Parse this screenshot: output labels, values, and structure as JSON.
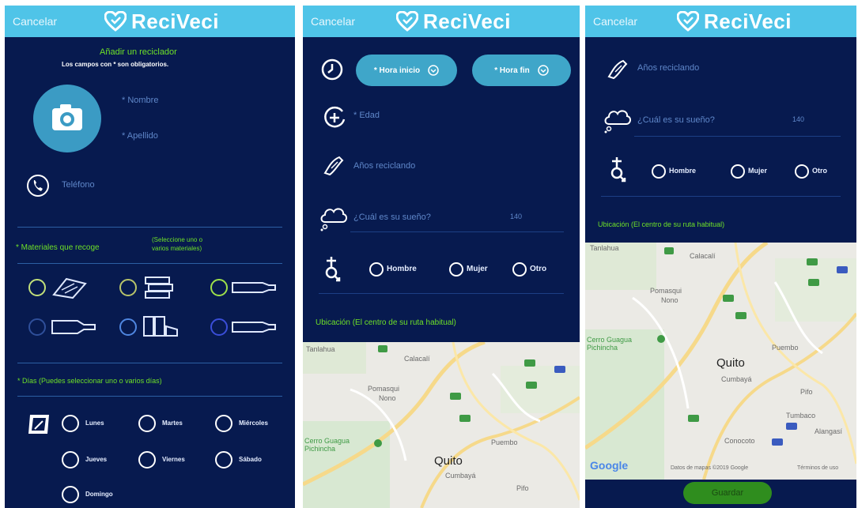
{
  "app": {
    "brand": "ReciVeci",
    "cancel_label": "Cancelar"
  },
  "screen1": {
    "title": "Añadir un reciclador",
    "required_note": "Los campos con * son obligatorios.",
    "name_placeholder": "* Nombre",
    "lastname_placeholder": "* Apellido",
    "phone_placeholder": "Teléfono",
    "materials_label": "* Materiales que recoge",
    "materials_hint": "(Seleccione uno o varios materiales)",
    "days_label": "* Días (Puedes seleccionar uno o varios días)",
    "days": [
      "Lunes",
      "Martes",
      "Miércoles",
      "Jueves",
      "Viernes",
      "Sábado",
      "Domingo"
    ]
  },
  "screen2": {
    "start_time": "* Hora inicio",
    "end_time": "* Hora fin",
    "age_placeholder": "* Edad",
    "years_placeholder": "Años reciclando",
    "dream_placeholder": "¿Cuál es su sueño?",
    "dream_counter": "140",
    "genders": [
      "Hombre",
      "Mujer",
      "Otro"
    ],
    "location_label": "Ubicación (El centro de su ruta habitual)"
  },
  "screen3": {
    "years_placeholder": "Años reciclando",
    "dream_placeholder": "¿Cuál es su sueño?",
    "dream_counter": "140",
    "genders": [
      "Hombre",
      "Mujer",
      "Otro"
    ],
    "location_label": "Ubicación (El centro de su ruta habitual)",
    "map_attribution": "Datos de mapas ©2019 Google",
    "map_terms": "Términos de uso",
    "google_logo": "Google",
    "save_label": "Guardar"
  },
  "map": {
    "city": "Quito",
    "places": [
      "Tanlahua",
      "Calacalí",
      "Pomasqui",
      "Nono",
      "Cerro Guagua Pichincha",
      "Puembo",
      "Cumbayá",
      "Pifo",
      "Tumbaco",
      "Conocoto",
      "Alangasí"
    ]
  },
  "colors": {
    "background": "#071a4f",
    "topbar": "#4fc4e8",
    "accent": "#6ee027",
    "pill": "#3fa6c9"
  }
}
